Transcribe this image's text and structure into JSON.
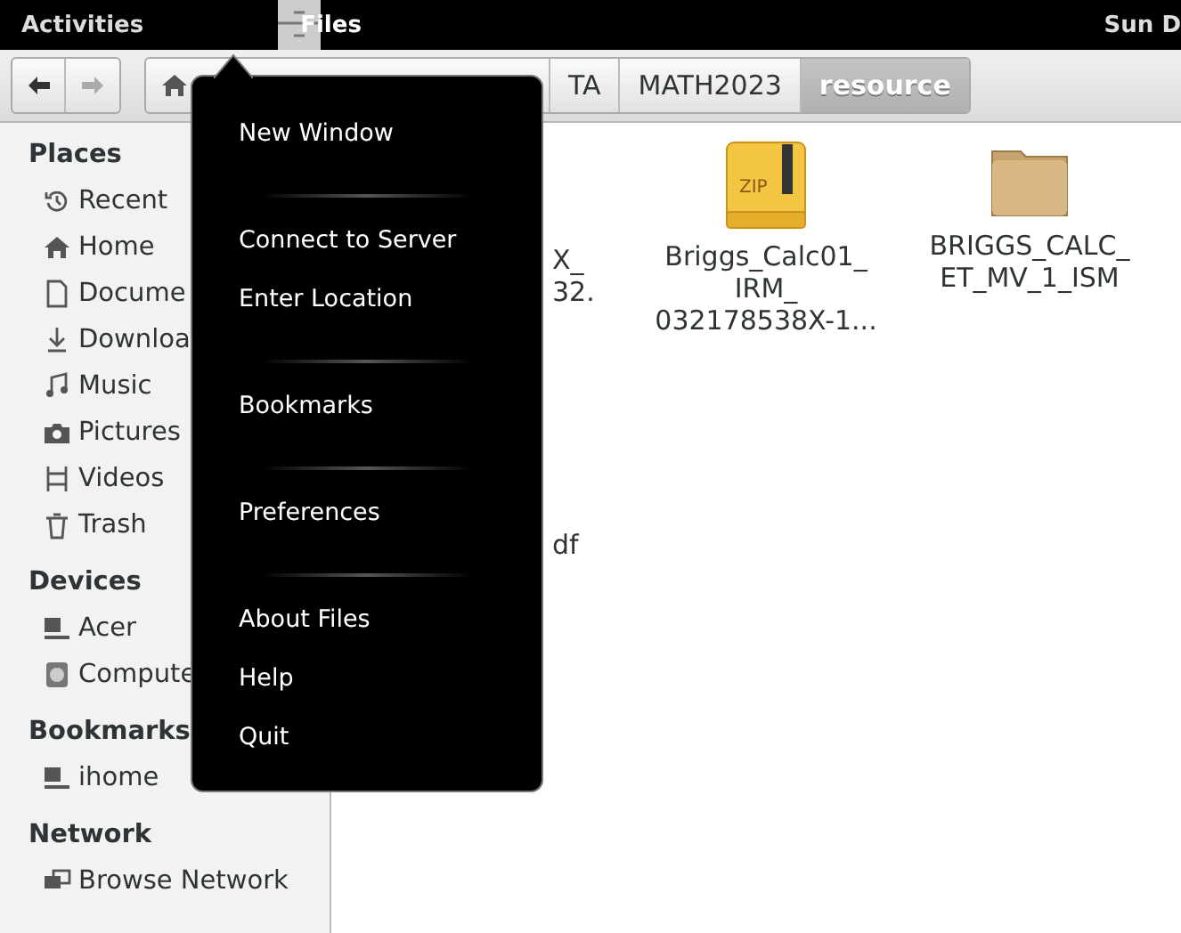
{
  "top_bar": {
    "activities": "Activities",
    "app_name": "Files",
    "clock": "Sun D"
  },
  "toolbar": {
    "back_enabled": true,
    "forward_enabled": false,
    "path": [
      {
        "label": "TA",
        "selected": false
      },
      {
        "label": "MATH2023",
        "selected": false
      },
      {
        "label": "resource",
        "selected": true
      }
    ]
  },
  "sidebar": {
    "sections": [
      {
        "title": "Places",
        "items": [
          {
            "label": "Recent",
            "kind": "recent"
          },
          {
            "label": "Home",
            "kind": "home"
          },
          {
            "label": "Docume",
            "kind": "document"
          },
          {
            "label": "Downloa",
            "kind": "download"
          },
          {
            "label": "Music",
            "kind": "music"
          },
          {
            "label": "Pictures",
            "kind": "pictures"
          },
          {
            "label": "Videos",
            "kind": "videos"
          },
          {
            "label": "Trash",
            "kind": "trash"
          }
        ]
      },
      {
        "title": "Devices",
        "items": [
          {
            "label": "Acer",
            "kind": "computer"
          },
          {
            "label": "Compute",
            "kind": "disk"
          }
        ]
      },
      {
        "title": "Bookmarks",
        "items": [
          {
            "label": "ihome",
            "kind": "computer"
          }
        ]
      },
      {
        "title": "Network",
        "items": [
          {
            "label": "Browse Network",
            "kind": "network"
          }
        ]
      }
    ]
  },
  "files": [
    {
      "kind": "hidden",
      "lines": [
        "X_",
        "32."
      ]
    },
    {
      "kind": "zip",
      "icon_label": "ZIP",
      "lines": [
        "Briggs_Calc01_",
        "IRM_",
        "032178538X-1..."
      ]
    },
    {
      "kind": "folder",
      "lines": [
        "BRIGGS_CALC_",
        "ET_MV_1_ISM"
      ]
    },
    {
      "kind": "hidden",
      "lines": [
        "df"
      ]
    }
  ],
  "app_menu": {
    "items": [
      {
        "kind": "item",
        "label": "New Window"
      },
      {
        "kind": "separator"
      },
      {
        "kind": "item",
        "label": "Connect to Server"
      },
      {
        "kind": "item",
        "label": "Enter Location"
      },
      {
        "kind": "separator"
      },
      {
        "kind": "item",
        "label": "Bookmarks"
      },
      {
        "kind": "separator"
      },
      {
        "kind": "item",
        "label": "Preferences"
      },
      {
        "kind": "separator"
      },
      {
        "kind": "item",
        "label": "About Files"
      },
      {
        "kind": "item",
        "label": "Help"
      },
      {
        "kind": "item",
        "label": "Quit"
      }
    ]
  }
}
